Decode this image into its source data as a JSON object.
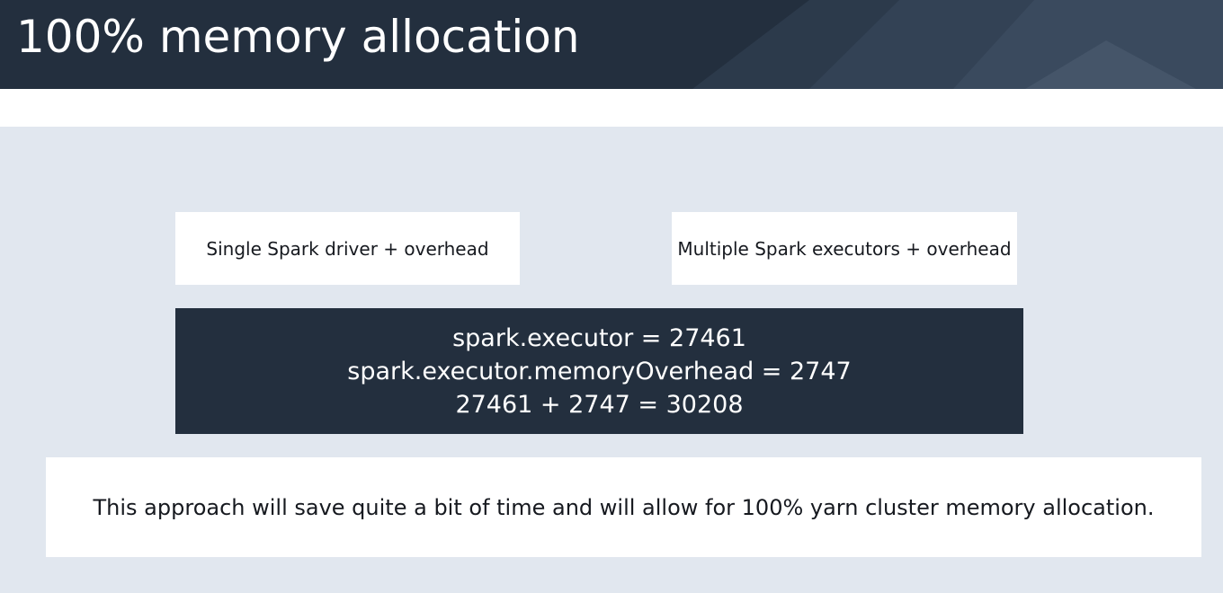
{
  "slide": {
    "title": "100% memory allocation"
  },
  "boxes": {
    "left_label": "Single Spark driver + overhead",
    "right_label": "Multiple Spark executors + overhead"
  },
  "formula": {
    "lines": [
      "spark.executor = 27461",
      "spark.executor.memoryOverhead = 2747",
      "27461 + 2747 = 30208"
    ]
  },
  "note": {
    "text": "This approach will save quite a bit of time and will allow for 100% yarn cluster memory allocation."
  },
  "colors": {
    "header_bg": "#232f3e",
    "content_bg": "#e1e7ef",
    "formula_bg": "#232f3e",
    "text_dark": "#16191f"
  }
}
